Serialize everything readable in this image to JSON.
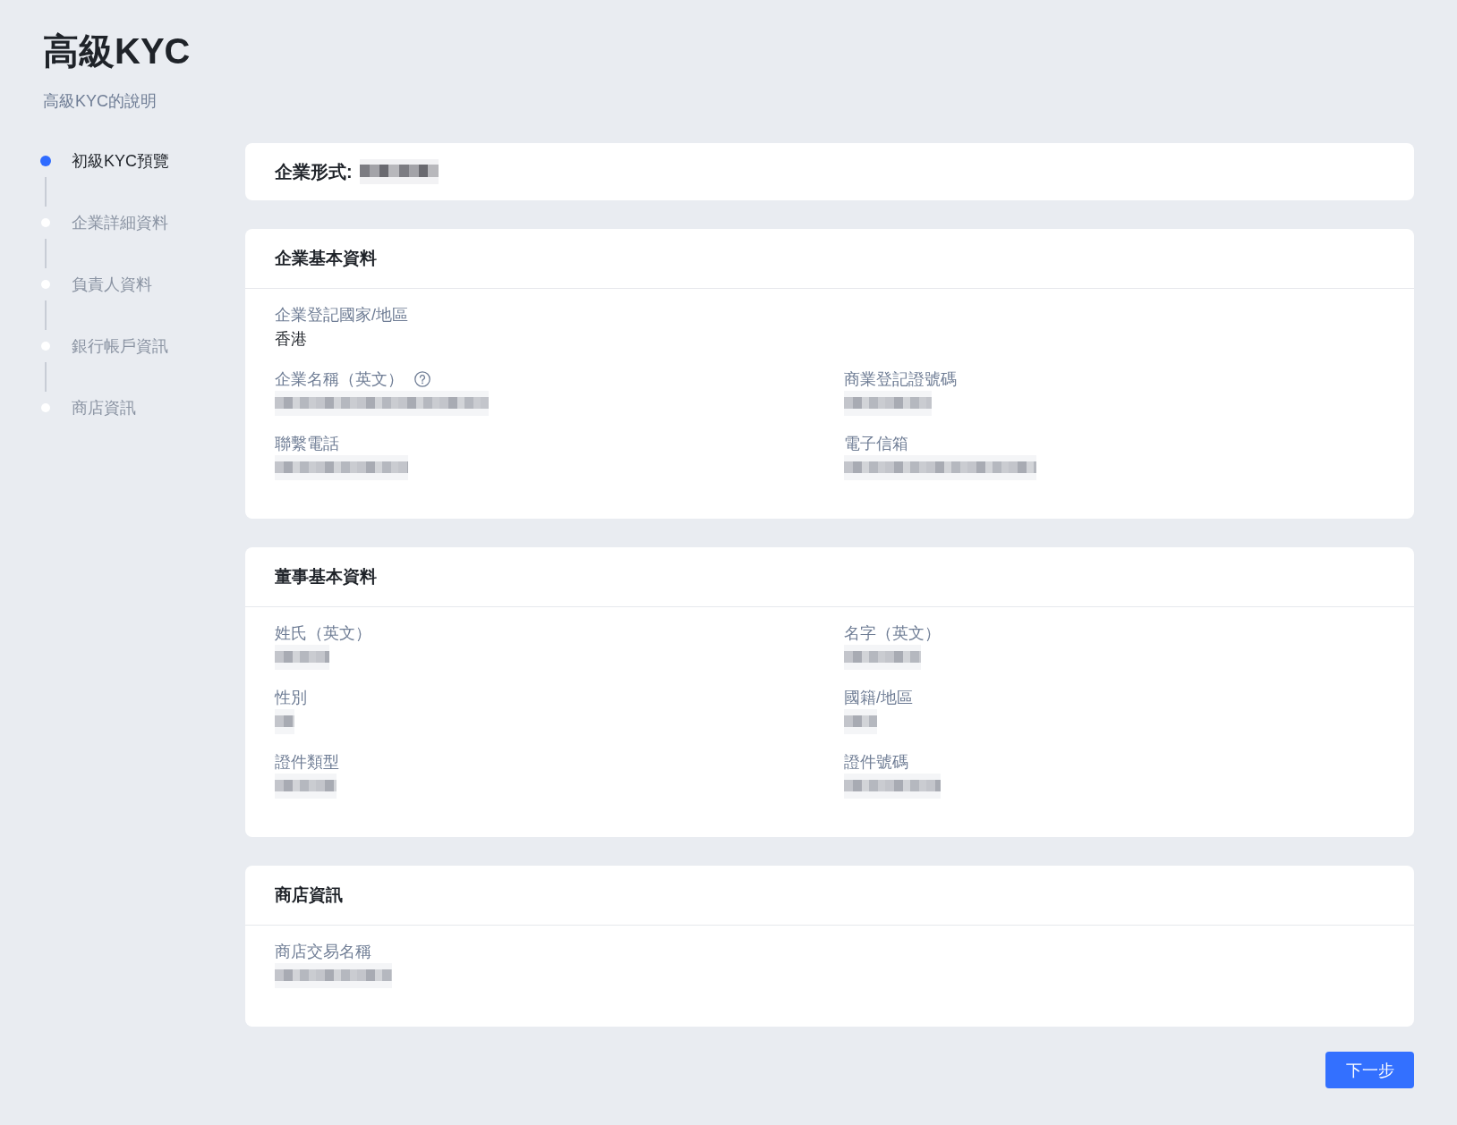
{
  "header": {
    "title": "高級KYC",
    "subtitle": "高級KYC的說明"
  },
  "steps": [
    {
      "label": "初級KYC預覽",
      "selected": true
    },
    {
      "label": "企業詳細資料",
      "selected": false
    },
    {
      "label": "負責人資料",
      "selected": false
    },
    {
      "label": "銀行帳戶資訊",
      "selected": false
    },
    {
      "label": "商店資訊",
      "selected": false
    }
  ],
  "cards": [
    {
      "kind": "inline",
      "label": "企業形式:",
      "redacted": true
    },
    {
      "kind": "section",
      "title": "企業基本資料",
      "rows": [
        [
          {
            "label": "企業登記國家/地區",
            "value": "香港",
            "redacted": false
          }
        ],
        [
          {
            "label": "企業名稱（英文）",
            "redacted": true,
            "help": true
          },
          {
            "label": "商業登記證號碼",
            "redacted": true
          }
        ],
        [
          {
            "label": "聯繫電話",
            "redacted": true
          },
          {
            "label": "電子信箱",
            "redacted": true
          }
        ]
      ]
    },
    {
      "kind": "section",
      "title": "董事基本資料",
      "rows": [
        [
          {
            "label": "姓氏（英文）",
            "redacted": true
          },
          {
            "label": "名字（英文）",
            "redacted": true
          }
        ],
        [
          {
            "label": "性別",
            "redacted": true
          },
          {
            "label": "國籍/地區",
            "redacted": true
          }
        ],
        [
          {
            "label": "證件類型",
            "redacted": true
          },
          {
            "label": "證件號碼",
            "redacted": true
          }
        ]
      ]
    },
    {
      "kind": "section",
      "title": "商店資訊",
      "rows": [
        [
          {
            "label": "商店交易名稱",
            "redacted": true
          }
        ]
      ]
    }
  ],
  "next_button": {
    "label": "下一步"
  }
}
